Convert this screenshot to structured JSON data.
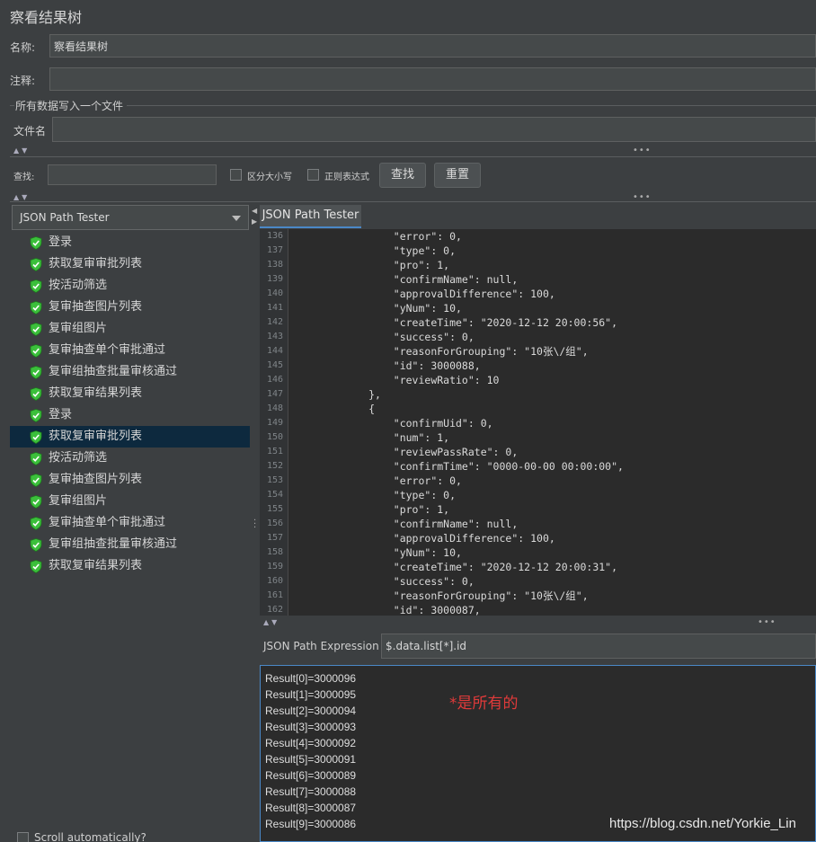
{
  "window": {
    "title": "察看结果树"
  },
  "form": {
    "name_label": "名称:",
    "name_value": "察看结果树",
    "comment_label": "注释:",
    "comment_value": "",
    "file_group_title": "所有数据写入一个文件",
    "filename_label": "文件名",
    "filename_value": ""
  },
  "search": {
    "label": "查找:",
    "value": "",
    "case_sensitive_label": "区分大小写",
    "regex_label": "正则表达式",
    "find_button": "查找",
    "reset_button": "重置"
  },
  "renderer": {
    "selected": "JSON Path Tester"
  },
  "tree": {
    "items": [
      {
        "label": "登录",
        "selected": false
      },
      {
        "label": "获取复审审批列表",
        "selected": false
      },
      {
        "label": "按活动筛选",
        "selected": false
      },
      {
        "label": "复审抽查图片列表",
        "selected": false
      },
      {
        "label": "复审组图片",
        "selected": false
      },
      {
        "label": "复审抽查单个审批通过",
        "selected": false
      },
      {
        "label": "复审组抽查批量审核通过",
        "selected": false
      },
      {
        "label": "获取复审结果列表",
        "selected": false
      },
      {
        "label": "登录",
        "selected": false
      },
      {
        "label": "获取复审审批列表",
        "selected": true
      },
      {
        "label": "按活动筛选",
        "selected": false
      },
      {
        "label": "复审抽查图片列表",
        "selected": false
      },
      {
        "label": "复审组图片",
        "selected": false
      },
      {
        "label": "复审抽查单个审批通过",
        "selected": false
      },
      {
        "label": "复审组抽查批量审核通过",
        "selected": false
      },
      {
        "label": "获取复审结果列表",
        "selected": false
      }
    ],
    "scroll_auto_label": "Scroll automatically?"
  },
  "tabs": [
    {
      "label": "JSON Path Tester",
      "active": true
    }
  ],
  "code": {
    "lines": [
      {
        "n": "136",
        "text": "                \"error\": 0,"
      },
      {
        "n": "137",
        "text": "                \"type\": 0,"
      },
      {
        "n": "138",
        "text": "                \"pro\": 1,"
      },
      {
        "n": "139",
        "text": "                \"confirmName\": null,"
      },
      {
        "n": "140",
        "text": "                \"approvalDifference\": 100,"
      },
      {
        "n": "141",
        "text": "                \"yNum\": 10,"
      },
      {
        "n": "142",
        "text": "                \"createTime\": \"2020-12-12 20:00:56\","
      },
      {
        "n": "143",
        "text": "                \"success\": 0,"
      },
      {
        "n": "144",
        "text": "                \"reasonForGrouping\": \"10张\\/组\","
      },
      {
        "n": "145",
        "text": "                \"id\": 3000088,"
      },
      {
        "n": "146",
        "text": "                \"reviewRatio\": 10"
      },
      {
        "n": "147",
        "text": "            },"
      },
      {
        "n": "148",
        "text": "            {"
      },
      {
        "n": "149",
        "text": "                \"confirmUid\": 0,"
      },
      {
        "n": "150",
        "text": "                \"num\": 1,"
      },
      {
        "n": "151",
        "text": "                \"reviewPassRate\": 0,"
      },
      {
        "n": "152",
        "text": "                \"confirmTime\": \"0000-00-00 00:00:00\","
      },
      {
        "n": "153",
        "text": "                \"error\": 0,"
      },
      {
        "n": "154",
        "text": "                \"type\": 0,"
      },
      {
        "n": "155",
        "text": "                \"pro\": 1,"
      },
      {
        "n": "156",
        "text": "                \"confirmName\": null,"
      },
      {
        "n": "157",
        "text": "                \"approvalDifference\": 100,"
      },
      {
        "n": "158",
        "text": "                \"yNum\": 10,"
      },
      {
        "n": "159",
        "text": "                \"createTime\": \"2020-12-12 20:00:31\","
      },
      {
        "n": "160",
        "text": "                \"success\": 0,"
      },
      {
        "n": "161",
        "text": "                \"reasonForGrouping\": \"10张\\/组\","
      },
      {
        "n": "162",
        "text": "                \"id\": 3000087,"
      }
    ]
  },
  "jsonpath": {
    "label": "JSON Path Expression",
    "value": "$.data.list[*].id"
  },
  "results": [
    "Result[0]=3000096",
    "Result[1]=3000095",
    "Result[2]=3000094",
    "Result[3]=3000093",
    "Result[4]=3000092",
    "Result[5]=3000091",
    "Result[6]=3000089",
    "Result[7]=3000088",
    "Result[8]=3000087",
    "Result[9]=3000086"
  ],
  "annotation": "*是所有的",
  "watermark": "https://blog.csdn.net/Yorkie_Lin",
  "colors": {
    "background": "#3c3f41",
    "editor_bg": "#2b2b2b",
    "selection": "#0d293e",
    "accent": "#4a88c7",
    "annotation": "#e03a3a",
    "success_icon": "#3bbf3b"
  }
}
